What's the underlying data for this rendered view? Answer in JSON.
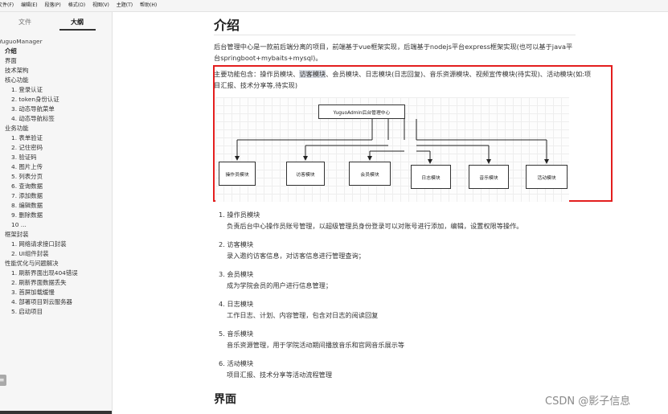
{
  "menubar": {
    "items": [
      "文件(F)",
      "编辑(E)",
      "段落(P)",
      "格式(O)",
      "视图(V)",
      "主题(T)",
      "帮助(H)"
    ]
  },
  "sidebar": {
    "tabs": [
      "文件",
      "大纲"
    ],
    "active_tab": "大纲",
    "badge": "≡",
    "outline": [
      {
        "label": "YuguoManager",
        "level": 0
      },
      {
        "label": "介绍",
        "level": 1,
        "active": true
      },
      {
        "label": "界面",
        "level": 1
      },
      {
        "label": "技术架构",
        "level": 1
      },
      {
        "label": "核心功能",
        "level": 1
      },
      {
        "label": "1. 登录认证",
        "level": 2
      },
      {
        "label": "2. token身份认证",
        "level": 2
      },
      {
        "label": "3. 动态导航菜单",
        "level": 2
      },
      {
        "label": "4. 动态导航标签",
        "level": 2
      },
      {
        "label": "业务功能",
        "level": 1
      },
      {
        "label": "1. 表单验证",
        "level": 2
      },
      {
        "label": "2. 记住密码",
        "level": 2
      },
      {
        "label": "3. 验证码",
        "level": 2
      },
      {
        "label": "4. 图片上传",
        "level": 2
      },
      {
        "label": "5. 列表分页",
        "level": 2
      },
      {
        "label": "6. 查询数据",
        "level": 2
      },
      {
        "label": "7. 添加数据",
        "level": 2
      },
      {
        "label": "8. 编辑数据",
        "level": 2
      },
      {
        "label": "9. 删除数据",
        "level": 2
      },
      {
        "label": "10 ...",
        "level": 2
      },
      {
        "label": "框架封装",
        "level": 1
      },
      {
        "label": "1. 网络请求接口封装",
        "level": 2
      },
      {
        "label": "2. UI组件封装",
        "level": 2
      },
      {
        "label": "性能优化与问题解决",
        "level": 1
      },
      {
        "label": "1. 刷新界面出现404错误",
        "level": 2
      },
      {
        "label": "2. 刷新界面数据丢失",
        "level": 2
      },
      {
        "label": "3. 首屏加载缓慢",
        "level": 2
      },
      {
        "label": "4. 部署项目到云服务器",
        "level": 2
      },
      {
        "label": "5. 启动项目",
        "level": 2
      }
    ]
  },
  "content": {
    "title": "介绍",
    "intro": "后台管理中心是一款前后端分离的项目，前端基于vue框架实现，后端基于nodejs平台express框架实现(也可以基于java平台springboot+mybaits+mysql)。",
    "features_pre": "主要功能包含：操作员模块、",
    "features_sel": "访客模块",
    "features_post": "、会员模块、日志模块(日志回复)、音乐资源模块、视频宣传模块(待实现)、活动模块(如:项目汇报、技术分享等,待实现)",
    "diagram": {
      "root": "YuguoAdmin后台管理中心",
      "children": [
        "操作员模块",
        "访客模块",
        "会员模块",
        "日志模块",
        "音乐模块",
        "活动模块"
      ]
    },
    "modules": [
      {
        "title": "1. 操作员模块",
        "desc": "负责后台中心操作员账号管理，以超级管理员身份登录可以对账号进行添加，编辑，设置权限等操作。"
      },
      {
        "title": "2. 访客模块",
        "desc": "录入邀约访客信息，对访客信息进行管理查询；"
      },
      {
        "title": "3. 会员模块",
        "desc": "成为学院会员的用户进行信息管理；"
      },
      {
        "title": "4. 日志模块",
        "desc": "工作日志、计划、内容管理，包含对日志的阅读回复"
      },
      {
        "title": "5. 音乐模块",
        "desc": "音乐资源管理，用于学院活动期间播放音乐和官网音乐展示等"
      },
      {
        "title": "6. 活动模块",
        "desc": "项目汇报、技术分享等活动流程管理"
      }
    ],
    "next_section": "界面"
  },
  "watermark": "CSDN @影子信息"
}
